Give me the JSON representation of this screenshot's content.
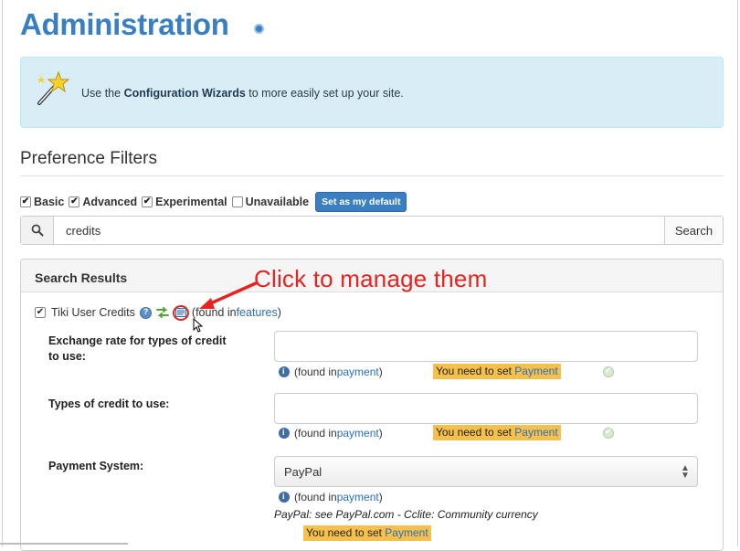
{
  "page": {
    "title": "Administration"
  },
  "wizard": {
    "text_before": "Use the ",
    "link": "Configuration Wizards",
    "text_after": " to more easily set up your site."
  },
  "filters": {
    "title": "Preference Filters",
    "options": [
      {
        "label": "Basic",
        "checked": true
      },
      {
        "label": "Advanced",
        "checked": true
      },
      {
        "label": "Experimental",
        "checked": true
      },
      {
        "label": "Unavailable",
        "checked": false
      }
    ],
    "default_button": "Set as my default"
  },
  "search": {
    "value": "credits",
    "button": "Search"
  },
  "results": {
    "header": "Search Results",
    "annotation": "Click to manage them",
    "feature": {
      "label": "Tiki User Credits",
      "checked": true,
      "found_prefix": "(found in ",
      "found_link": "features",
      "found_suffix": ")"
    },
    "fields": [
      {
        "label": "Exchange rate for types of credit to use:",
        "type": "text",
        "value": "",
        "found_prefix": "(found in ",
        "found_link": "payment",
        "found_suffix": ")",
        "warning_text": "You need to set ",
        "warning_link": "Payment"
      },
      {
        "label": "Types of credit to use:",
        "type": "text",
        "value": "",
        "found_prefix": "(found in ",
        "found_link": "payment",
        "found_suffix": ")",
        "warning_text": "You need to set ",
        "warning_link": "Payment"
      },
      {
        "label": "Payment System:",
        "type": "select",
        "value": "PayPal",
        "found_prefix": "(found in ",
        "found_link": "payment",
        "found_suffix": ")",
        "description": "PayPal: see PayPal.com - Cclite: Community currency",
        "warning_text": "You need to set ",
        "warning_link": "Payment"
      }
    ]
  },
  "colors": {
    "title_blue": "#3a7fc1",
    "link_blue": "#2a6ebb",
    "info_bg": "#d9edf7",
    "warning_bg": "#f5c14c",
    "annotation_red": "#e8221e"
  }
}
